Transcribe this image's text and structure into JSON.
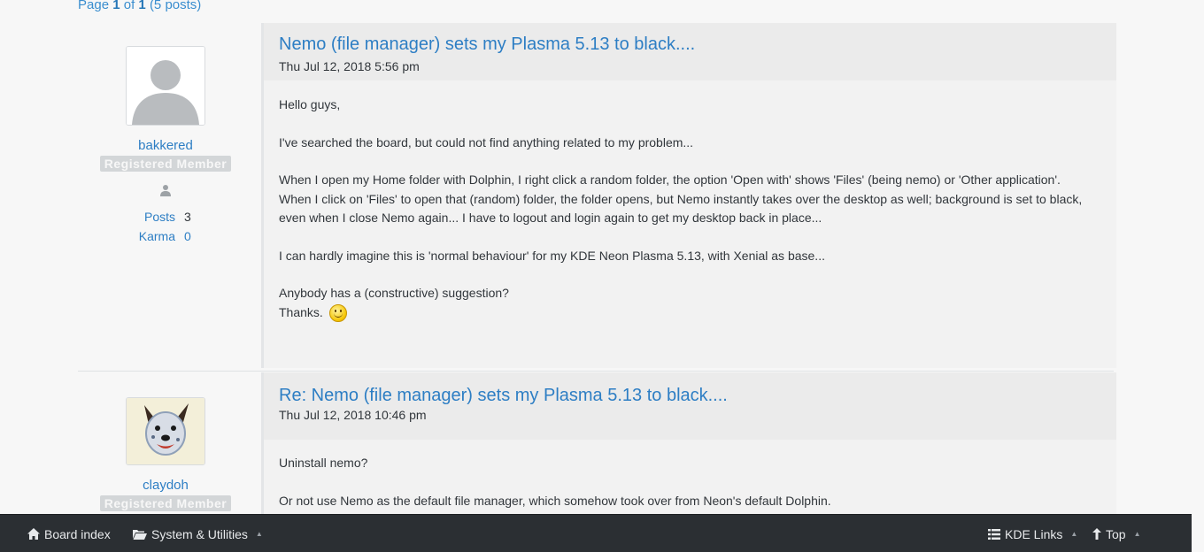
{
  "pagination": {
    "page_label": "Page",
    "current": "1",
    "of_label": "of",
    "total": "1",
    "posts_count": "(5 posts)"
  },
  "posts": [
    {
      "author": "bakkered",
      "rank": "Registered Member",
      "stats": {
        "posts_label": "Posts",
        "posts_value": "3",
        "karma_label": "Karma",
        "karma_value": "0"
      },
      "title": "Nemo (file manager) sets my Plasma 5.13 to black....",
      "date": "Thu Jul 12, 2018 5:56 pm",
      "paragraphs": [
        "Hello guys,",
        "I've searched the board, but could not find anything related to my problem...",
        "When I open my Home folder with Dolphin, I right click a random folder, the option 'Open with' shows 'Files' (being nemo) or 'Other application'.",
        "When I click on 'Files' to open that (random) folder, the folder opens, but Nemo instantly takes over the desktop as well; background is set to black, even when I close Nemo again... I have to logout and login again to get my desktop back in place...",
        "I can hardly imagine this is 'normal behaviour' for my KDE Neon Plasma 5.13, with Xenial as base...",
        "Anybody has a (constructive) suggestion?",
        "Thanks."
      ]
    },
    {
      "author": "claydoh",
      "rank": "Registered Member",
      "title": "Re: Nemo (file manager) sets my Plasma 5.13 to black....",
      "date": "Thu Jul 12, 2018 10:46 pm",
      "paragraphs": [
        "Uninstall nemo?",
        "Or not use Nemo as the default file manager, which somehow took over from Neon's default Dolphin."
      ]
    }
  ],
  "footer": {
    "board_index": "Board index",
    "system_utilities": "System & Utilities",
    "kde_links": "KDE Links",
    "top": "Top"
  },
  "icons": {
    "home": "home-icon",
    "folder": "folder-open-icon",
    "list": "list-icon",
    "arrow_up": "arrow-up-icon",
    "user": "user-icon",
    "smiley": "smiley-icon"
  }
}
